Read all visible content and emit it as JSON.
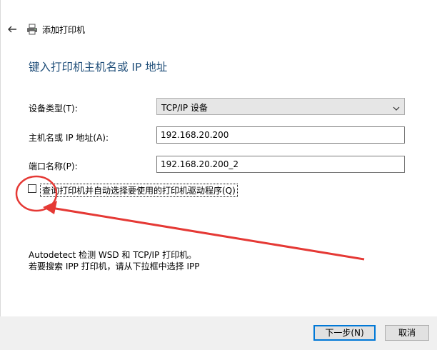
{
  "window": {
    "title": "添加打印机"
  },
  "heading": "键入打印机主机名或 IP 地址",
  "form": {
    "device_type_label": "设备类型(T):",
    "device_type_value": "TCP/IP 设备",
    "hostname_label": "主机名或 IP 地址(A):",
    "hostname_value": "192.168.20.200",
    "port_label": "端口名称(P):",
    "port_value": "192.168.20.200_2",
    "query_checkbox_label": "查询打印机并自动选择要使用的打印机驱动程序(Q)",
    "query_checkbox_checked": false
  },
  "info": {
    "line1": "Autodetect 检测 WSD 和 TCP/IP 打印机。",
    "line2": "若要搜索 IPP 打印机，请从下拉框中选择 IPP"
  },
  "buttons": {
    "next": "下一步(N)",
    "cancel": "取消"
  },
  "annotation": {
    "color": "#e53935"
  },
  "icons": {
    "back": "back-arrow-icon",
    "printer": "printer-icon",
    "dropdown": "chevron-down-icon"
  }
}
